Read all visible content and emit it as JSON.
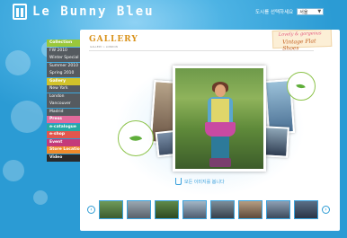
{
  "brand": {
    "name": "Le Bunny Bleu"
  },
  "header": {
    "store_label": "도시를 선택하세요",
    "store_select_value": "서울"
  },
  "gallery": {
    "title": "GALLERY",
    "subtitle": "GALLERY > LONDON",
    "banner_line1": "Lovely & gorgeous",
    "banner_line2": "Vintage Flat Shoes",
    "play_label": "모든 이미지를 봅니다"
  },
  "thumbnails": {
    "count": 8
  },
  "nav": {
    "collection": "Collection",
    "collection_items": [
      "FW 2010",
      "Winter Special",
      "Summer 2010",
      "Spring 2010"
    ],
    "gallery": "Gallery",
    "gallery_items": [
      "New York",
      "London",
      "Vancouver",
      "Madrid"
    ],
    "press": "Press",
    "e_catalogue": "e-catalogue",
    "e_shop": "e-shop",
    "event": "Event",
    "store_location": "Store Location",
    "video": "Video"
  },
  "colors": {
    "background": "#35a7dd",
    "accent_orange": "#d9931d",
    "link_blue": "#39a0dc"
  }
}
